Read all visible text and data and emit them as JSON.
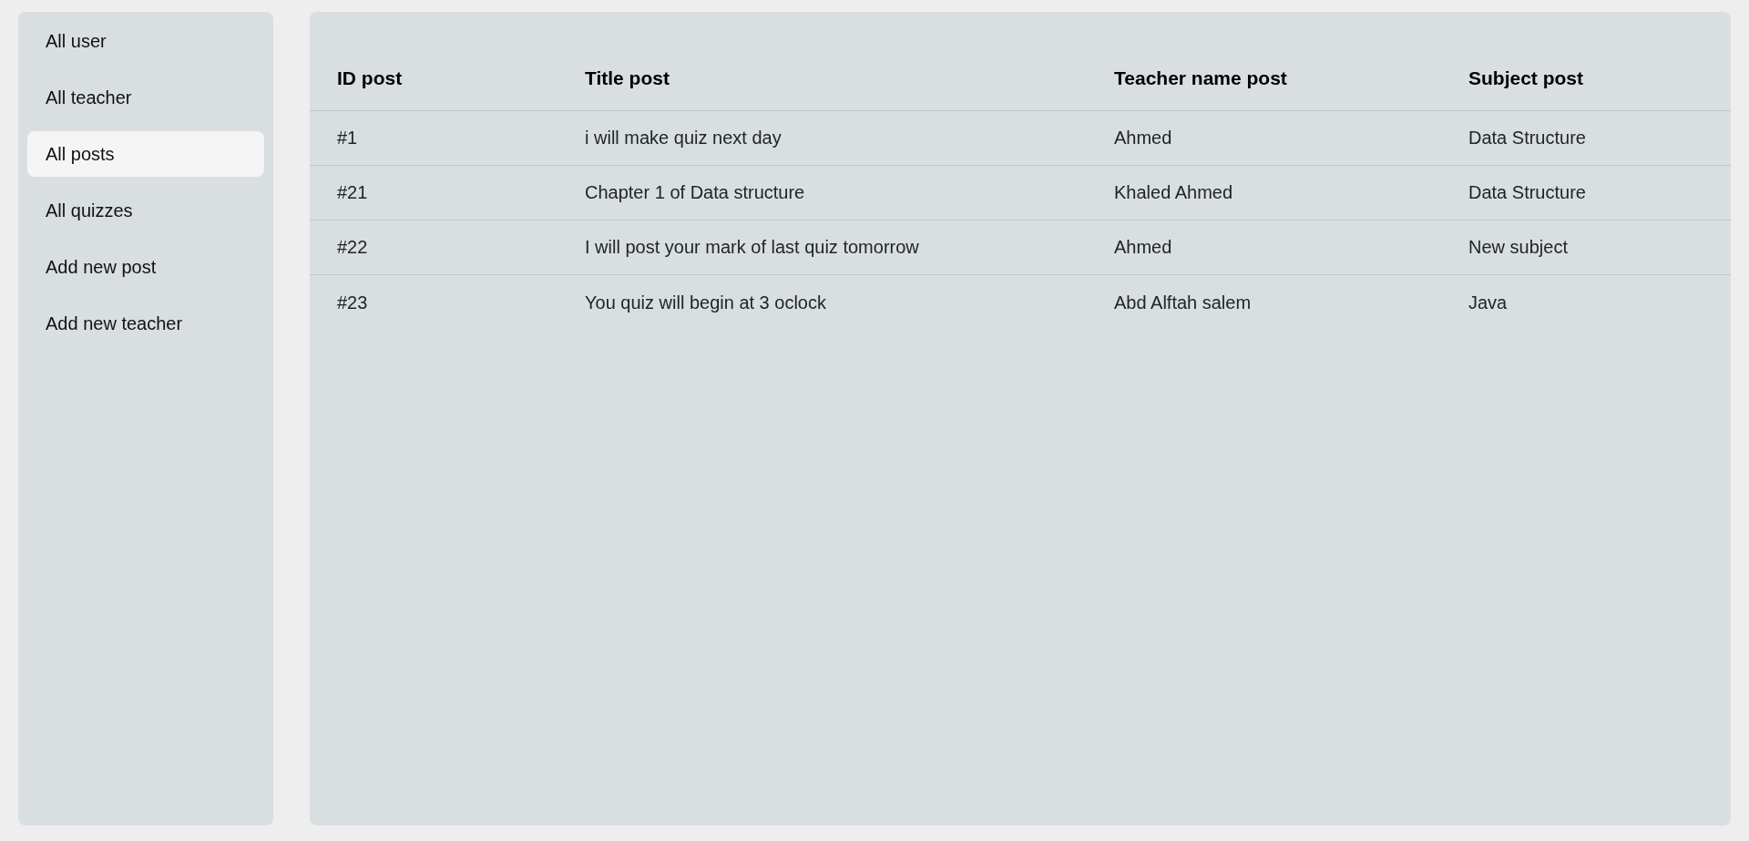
{
  "sidebar": {
    "items": [
      {
        "label": "All user",
        "selected": false
      },
      {
        "label": "All teacher",
        "selected": false
      },
      {
        "label": "All posts",
        "selected": true
      },
      {
        "label": "All quizzes",
        "selected": false
      },
      {
        "label": "Add new post",
        "selected": false
      },
      {
        "label": "Add new teacher",
        "selected": false
      }
    ]
  },
  "table": {
    "columns": [
      "ID post",
      "Title post",
      "Teacher name post",
      "Subject post"
    ],
    "rows": [
      [
        "#1",
        "i will make quiz next day",
        "Ahmed",
        "Data Structure"
      ],
      [
        "#21",
        "Chapter 1 of Data structure",
        "Khaled Ahmed",
        "Data Structure"
      ],
      [
        "#22",
        "I will post your mark of last quiz tomorrow",
        "Ahmed",
        "New subject"
      ],
      [
        "#23",
        "You quiz will begin at 3 oclock",
        "Abd Alftah salem",
        "Java"
      ]
    ]
  }
}
